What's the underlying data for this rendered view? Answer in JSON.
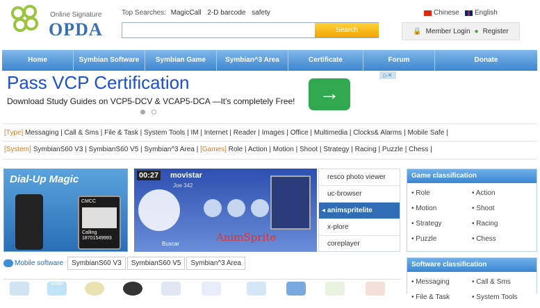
{
  "header": {
    "logo_small": "Online Signature",
    "logo_big": "OPDA",
    "top_searches_label": "Top Searches:",
    "top_searches": [
      "MagicCall",
      "2-D barcode",
      "safety"
    ],
    "search_placeholder": "",
    "search_button": "Search",
    "lang_chinese": "Chinese",
    "lang_english": "English",
    "member_login": "Member Login",
    "register": "Register"
  },
  "nav": [
    "Home",
    "Symbian Software",
    "Symbian Game",
    "Symbian^3 Area",
    "Certificate",
    "Forum",
    "Donate"
  ],
  "ad": {
    "title": "Pass VCP Certification",
    "subtitle": "Download Study Guides on VCP5-DCV & VCAP5-DCA —It's completely Free!"
  },
  "categories": {
    "type_tag": "[Type]",
    "type_items": "Messaging | Call & Sms | File & Task | System Tools | IM | Internet | Reader | Images | Office | Multimedia | Clocks& Alarms | Mobile Safe |",
    "system_tag": "[System]",
    "system_items": "SymbianS60 V3 | SymbianS60 V5 | Symbian^3 Area |",
    "games_tag": "[Games]",
    "games_items": "Role | Action | Motion | Shoot | Strategy | Racing | Puzzle | Chess |"
  },
  "banners": {
    "b1_title": "Dial-Up Magic",
    "b1_cmcc": "CMCC",
    "b1_calling": "Calling",
    "b1_number": "18701549993",
    "b2_time": "00:27",
    "b2_carrier": "movistar",
    "b2_joe": "Joe 342",
    "b2_buscar": "Buscar",
    "b2_caption": "AnimSprite"
  },
  "slides": [
    "resco photo viewer",
    "uc-browser",
    "animspritelite",
    "x-plore",
    "coreplayer"
  ],
  "game_panel": {
    "title": "Game classification",
    "items": [
      "Role",
      "Action",
      "Motion",
      "Shoot",
      "Strategy",
      "Racing",
      "Puzzle",
      "Chess"
    ]
  },
  "software_panel": {
    "title": "Software classification",
    "items": [
      "Messaging",
      "Call & Sms",
      "File & Task",
      "System Tools"
    ]
  },
  "tabs": {
    "label": "Mobile software",
    "items": [
      "SymbianS60 V3",
      "SymbianS60 V5",
      "Symbian^3 Area"
    ]
  },
  "icon_row": {
    "twitter": "twitter"
  },
  "colors": {
    "nav_blue": "#3e86cf",
    "ad_blue": "#1a4fd3",
    "tag_orange": "#e07a1a",
    "search_orange": "#f3a400"
  }
}
